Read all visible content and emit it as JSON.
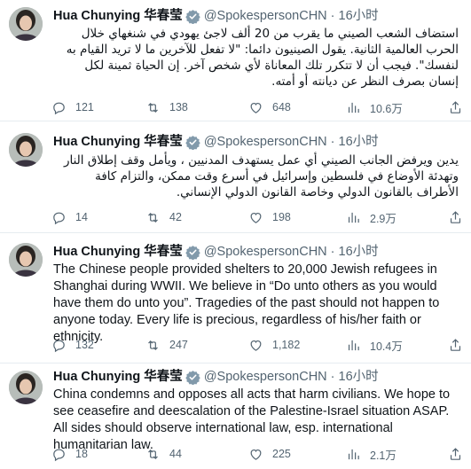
{
  "tweets": [
    {
      "name": "Hua Chunying 华春莹",
      "handle": "@SpokespersonCHN",
      "time": "16小时",
      "text": "استضاف الشعب الصيني ما يقرب من 20 ألف لاجئ يهودي في شنغهاي خلال الحرب العالمية الثانية. يقول الصينيون دائما: \"لا تفعل للآخرين ما لا تريد القيام به لنفسك\". فيجب أن لا تتكرر تلك المعاناة لأي شخص آخر. إن الحياة ثمينة لكل إنسان بصرف النظر عن ديانته أو أمته.",
      "direction": "rtl",
      "replies": "121",
      "retweets": "138",
      "likes": "648",
      "views": "10.6万"
    },
    {
      "name": "Hua Chunying 华春莹",
      "handle": "@SpokespersonCHN",
      "time": "16小时",
      "text": "يدين ويرفض الجانب الصيني أي عمل يستهدف المدنيين ، ويأمل وقف إطلاق النار وتهدئة الأوضاع في فلسطين وإسرائيل في أسرع وقت ممكن، والتزام كافة الأطراف بالقانون الدولي وخاصة القانون الدولي الإنساني.",
      "direction": "rtl",
      "replies": "14",
      "retweets": "42",
      "likes": "198",
      "views": "2.9万"
    },
    {
      "name": "Hua Chunying 华春莹",
      "handle": "@SpokespersonCHN",
      "time": "16小时",
      "text": "The Chinese people provided shelters to 20,000 Jewish refugees in Shanghai during WWII. We believe in “Do unto others as you would have them do unto you”. Tragedies of the past should not happen to anyone today. Every life is precious, regardless of his/her faith or ethnicity.",
      "direction": "ltr",
      "replies": "132",
      "retweets": "247",
      "likes": "1,182",
      "views": "10.4万"
    },
    {
      "name": "Hua Chunying 华春莹",
      "handle": "@SpokespersonCHN",
      "time": "16小时",
      "text": "China condemns and opposes all acts that harm civilians. We hope to see ceasefire and deescalation of the Palestine-Israel situation ASAP. All sides should observe international law, esp. international humanitarian law.",
      "direction": "ltr",
      "replies": "18",
      "retweets": "44",
      "likes": "225",
      "views": "2.1万"
    }
  ],
  "icons": {
    "verified": "verified-badge-icon",
    "reply": "reply-icon",
    "retweet": "retweet-icon",
    "like": "heart-icon",
    "views": "views-bar-chart-icon",
    "share": "share-icon"
  },
  "colors": {
    "verified_badge": "#829aab",
    "text": "#0f1419",
    "muted": "#536471",
    "divider": "#e6ecf0"
  }
}
